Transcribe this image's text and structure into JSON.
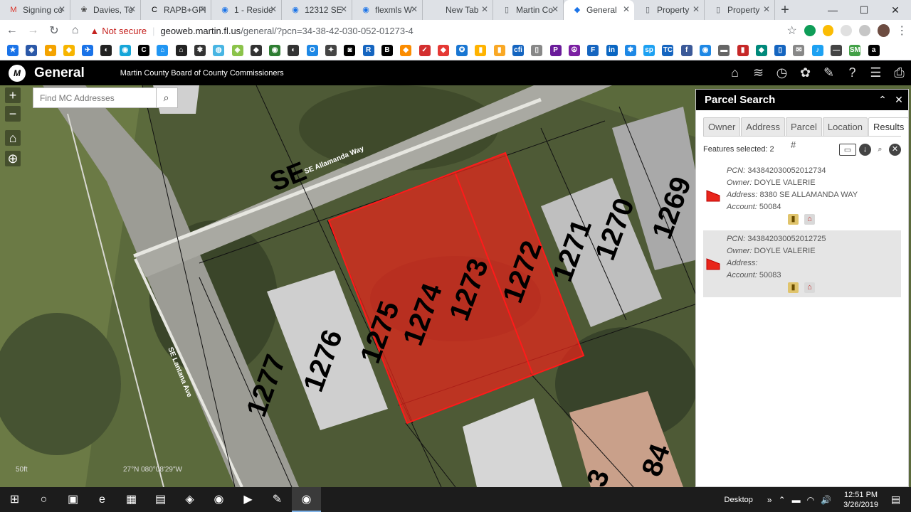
{
  "browser": {
    "tabs": [
      {
        "label": "Signing co",
        "icon": "M",
        "color": "#d93025"
      },
      {
        "label": "Davies, To",
        "icon": "❀",
        "color": "#444"
      },
      {
        "label": "RAPB+GFI",
        "icon": "C",
        "color": "#000"
      },
      {
        "label": "1 - Reside",
        "icon": "◉",
        "color": "#1a73e8"
      },
      {
        "label": "12312 SE",
        "icon": "◉",
        "color": "#1a73e8"
      },
      {
        "label": "flexmls W",
        "icon": "◉",
        "color": "#1a73e8"
      },
      {
        "label": "New Tab",
        "icon": "",
        "color": "#fff"
      },
      {
        "label": "Martin Co",
        "icon": "▯",
        "color": "#5f6368"
      },
      {
        "label": "General",
        "icon": "◆",
        "color": "#1a73e8"
      },
      {
        "label": "Property",
        "icon": "▯",
        "color": "#5f6368"
      },
      {
        "label": "Property",
        "icon": "▯",
        "color": "#5f6368"
      }
    ],
    "new_tab": "+",
    "window_controls": [
      "—",
      "☐",
      "✕"
    ],
    "warning_icon": "▲",
    "not_secure": "Not secure",
    "separator": "|",
    "url_host": "geoweb.martin.fl.us",
    "url_path": "/general/?pcn=34-38-42-030-052-01273-4",
    "star": "☆",
    "nav": {
      "back": "←",
      "forward": "→",
      "reload": "↻",
      "home": "⌂"
    },
    "menu": "⋮",
    "bookmark_colors": [
      "#1a73e8",
      "#2b58a8",
      "#f4a300",
      "#f7b500",
      "#1a73e8",
      "#222",
      "#16a6d9",
      "#000",
      "#2196f3",
      "#222",
      "#333",
      "#48b5e3",
      "#8bc34a",
      "#333",
      "#2e7d32",
      "#333",
      "#1e88e5",
      "#444",
      "#000",
      "#1565c0",
      "#000",
      "#fb8c00",
      "#d32f2f",
      "#e53935",
      "#1976d2",
      "#ffb300",
      "#f9a825",
      "#1565c0",
      "#888",
      "#6a1b9a",
      "#7b1fa2",
      "#1565c0",
      "#0a66c2",
      "#1e88e5",
      "#1da1f2",
      "#1565c0",
      "#3b5998",
      "#1e88e5",
      "#666",
      "#c62828",
      "#00897b",
      "#1565c0",
      "#888",
      "#1da1f2",
      "#444",
      "#43a047",
      "#000"
    ],
    "bookmark_icons": [
      "★",
      "◈",
      "●",
      "◆",
      "✈",
      "◐",
      "◉",
      "C",
      "⌂",
      "⌂",
      "✾",
      "◍",
      "◈",
      "◆",
      "◉",
      "◐",
      "O",
      "✦",
      "◙",
      "R",
      "B",
      "◆",
      "✓",
      "◆",
      "✪",
      "▮",
      "▮",
      "cfi",
      "▯",
      "P",
      "☮",
      "F",
      "in",
      "✾",
      "sp",
      "TC",
      "f",
      "◉",
      "▬",
      "▮",
      "◆",
      "▯",
      "✉",
      "♪",
      "—",
      "SM",
      "a"
    ]
  },
  "app": {
    "logo": "M",
    "name": "General",
    "agency": "Martin County Board of County Commissioners",
    "tools": [
      "⌂",
      "≋",
      "◷",
      "✿",
      "✎",
      "?",
      "☰",
      "⎙"
    ]
  },
  "map": {
    "zoom_in": "+",
    "zoom_out": "−",
    "home": "⌂",
    "locate": "⊕",
    "search_placeholder": "Find MC Addresses",
    "search_icon": "⌕",
    "scale_label": "50ft",
    "coords_label": "27°N   080°08'29\"W",
    "street_labels": [
      "SE Allamanda Way",
      "SE Lantana Ave",
      "SE"
    ],
    "parcel_labels": [
      "1277",
      "1276",
      "1275",
      "1274",
      "1273",
      "1272",
      "1271",
      "1270",
      "1269",
      "3",
      "84"
    ],
    "selection_color": "#e8251b"
  },
  "panel": {
    "title": "Parcel Search",
    "collapse": "⌃",
    "close": "✕",
    "tabs": [
      "Owner",
      "Address",
      "Parcel #",
      "Location",
      "Results"
    ],
    "active_tab": "Results",
    "features_label": "Features selected: 2",
    "tools": [
      "▭",
      "↓",
      "⌕",
      "✕"
    ],
    "results": [
      {
        "pcn_label": "PCN:",
        "pcn": "343842030052012734",
        "owner_label": "Owner:",
        "owner": "DOYLE VALERIE",
        "address_label": "Address:",
        "address": "8380 SE ALLAMANDA WAY",
        "account_label": "Account:",
        "account": "50084"
      },
      {
        "pcn_label": "PCN:",
        "pcn": "343842030052012725",
        "owner_label": "Owner:",
        "owner": "DOYLE VALERIE",
        "address_label": "Address:",
        "address": "",
        "account_label": "Account:",
        "account": "50083"
      }
    ],
    "flag_color": "#e8251b"
  },
  "taskbar": {
    "apps": [
      "⊞",
      "○",
      "▣",
      "e",
      "▦",
      "▤",
      "◈",
      "◉",
      "▶",
      "✎",
      "◉"
    ],
    "desktop_label": "Desktop",
    "chevron": "»",
    "tray_icons": [
      "⌃",
      "▬",
      "◠",
      "🔊"
    ],
    "time": "12:51 PM",
    "date": "3/26/2019",
    "notifications": "▤"
  }
}
